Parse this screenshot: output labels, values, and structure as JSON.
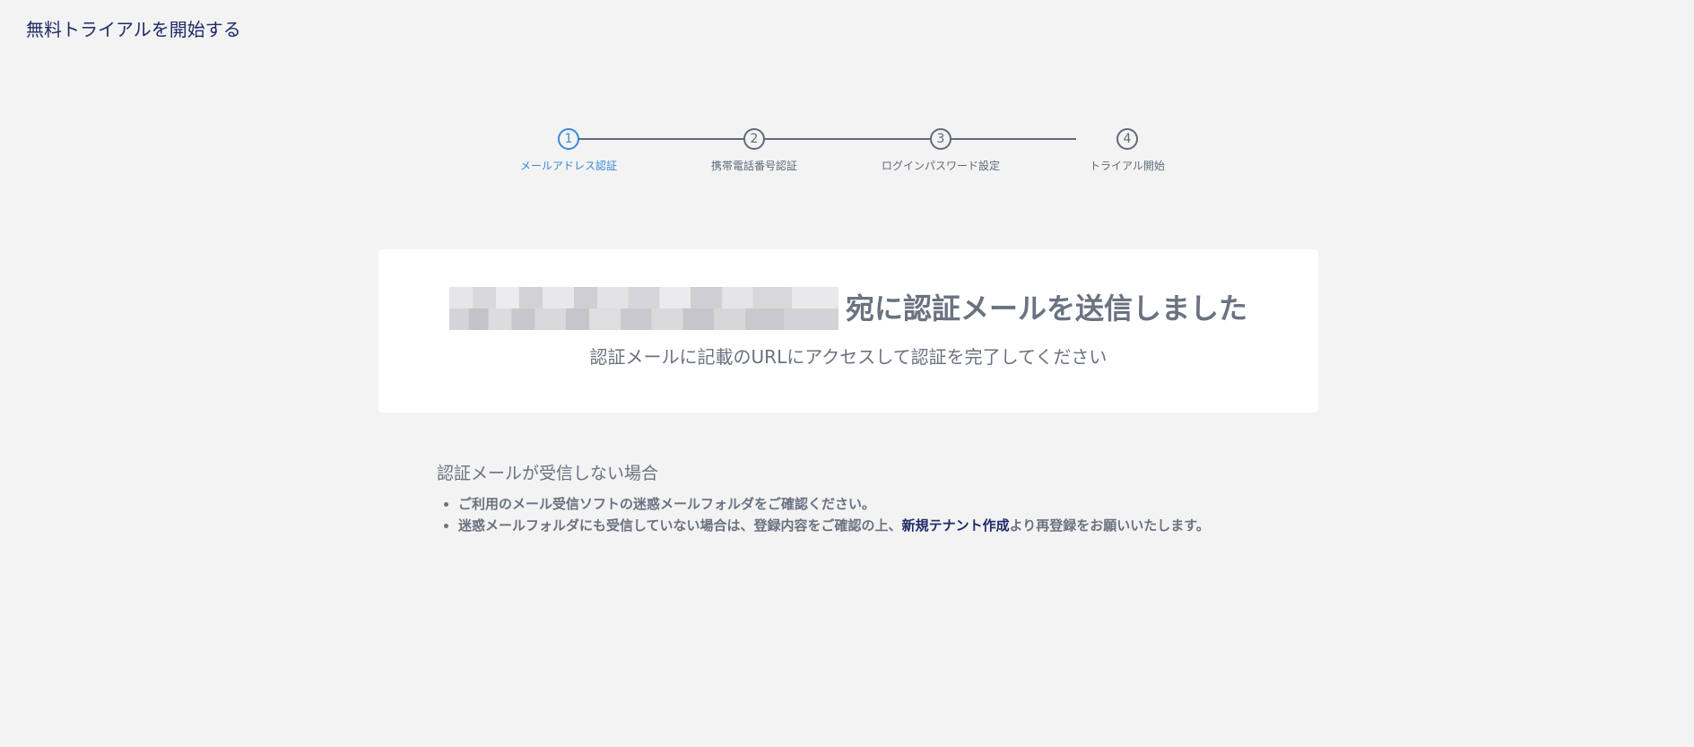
{
  "header": {
    "title": "無料トライアルを開始する"
  },
  "steps": [
    {
      "number": "1",
      "label": "メールアドレス認証",
      "active": true
    },
    {
      "number": "2",
      "label": "携帯電話番号認証",
      "active": false
    },
    {
      "number": "3",
      "label": "ログインパスワード設定",
      "active": false
    },
    {
      "number": "4",
      "label": "トライアル開始",
      "active": false
    }
  ],
  "card": {
    "headline_suffix": "宛に認証メールを送信しました",
    "subline": "認証メールに記載のURLにアクセスして認証を完了してください"
  },
  "help": {
    "title": "認証メールが受信しない場合",
    "item1": "ご利用のメール受信ソフトの迷惑メールフォルダをご確認ください。",
    "item2_before": "迷惑メールフォルダにも受信していない場合は、登録内容をご確認の上、",
    "item2_link": "新規テナント作成",
    "item2_after": "より再登録をお願いいたします。"
  },
  "colors": {
    "accent": "#3b8ad6",
    "title": "#1f2a66",
    "text": "#6b7280",
    "background": "#f3f3f3"
  }
}
